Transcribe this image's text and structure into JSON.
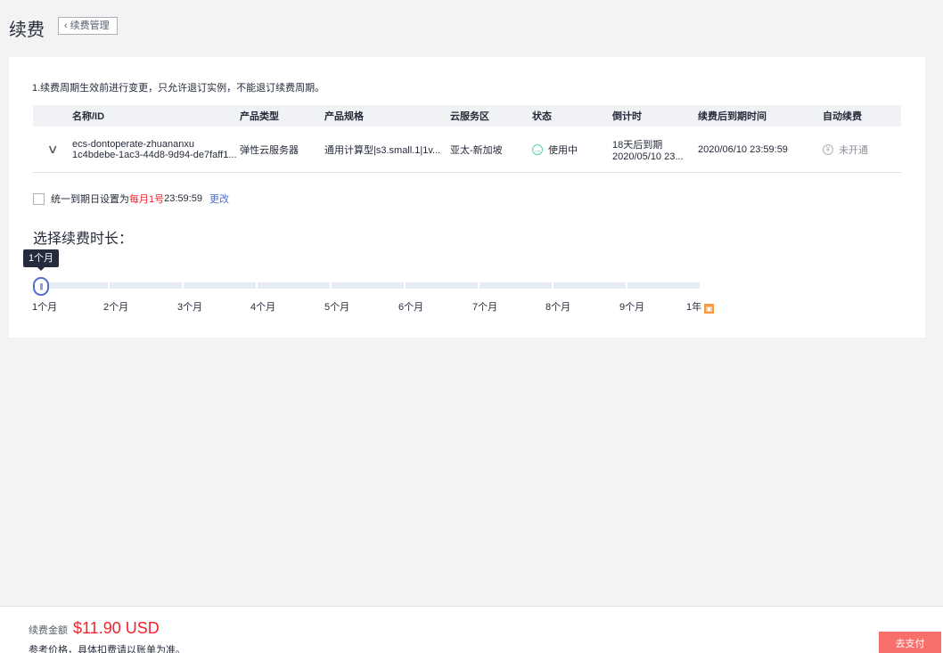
{
  "header": {
    "title": "续费",
    "back_label": "续费管理"
  },
  "note": "1.续费周期生效前进行变更，只允许退订实例，不能退订续费周期。",
  "table": {
    "columns": [
      "名称/ID",
      "产品类型",
      "产品规格",
      "云服务区",
      "状态",
      "倒计时",
      "续费后到期时间",
      "自动续费"
    ],
    "row": {
      "name": "ecs-dontoperate-zhuananxu",
      "id": "1c4bdebe-1ac3-44d8-9d94-de7faff1...",
      "type": "弹性云服务器",
      "spec": "通用计算型|s3.small.1|1v...",
      "region": "亚太-新加坡",
      "status": "使用中",
      "countdown": "18天后到期",
      "expire": "2020/05/10 23...",
      "new_expire": "2020/06/10 23:59:59",
      "auto_renew": "未开通"
    }
  },
  "unify": {
    "prefix": "统一到期日设置为",
    "highlight": "每月1号",
    "time": "23:59:59",
    "change": "更改"
  },
  "duration": {
    "title": "选择续费时长：",
    "tooltip": "1个月",
    "selected_index": 0,
    "ticks": [
      "1个月",
      "2个月",
      "3个月",
      "4个月",
      "5个月",
      "6个月",
      "7个月",
      "8个月",
      "9个月",
      "1年"
    ]
  },
  "footer": {
    "price_label": "续费金额",
    "price_value": "$11.90 USD",
    "price_note": "参考价格，具体扣费请以账单为准。",
    "pay_label": "去支付"
  },
  "icons": {
    "back": "chevron-left-icon",
    "expand": "chevron-down-icon",
    "status": "arrow-right-circle-icon",
    "auto_renew": "yen-circle-icon",
    "gift": "gift-icon"
  },
  "colors": {
    "accent": "#526ecc",
    "price": "#f5222d",
    "pay_button": "#f66f6a",
    "status": "#50d4ab",
    "gift": "#fa9841"
  }
}
